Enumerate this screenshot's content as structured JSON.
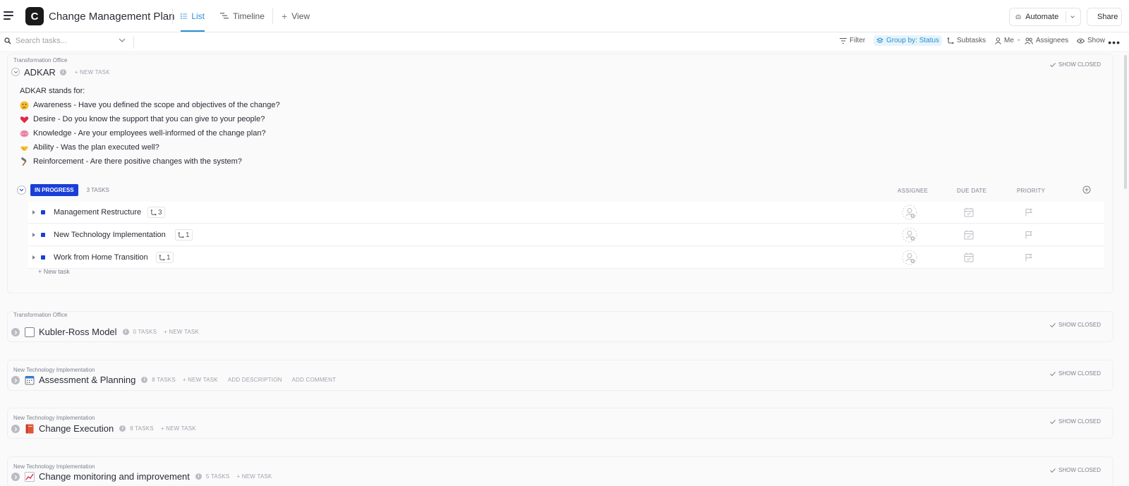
{
  "header": {
    "space_letter": "C",
    "list_title": "Change Management Plan",
    "tabs": [
      {
        "label": "List",
        "active": true
      },
      {
        "label": "Timeline",
        "active": false
      },
      {
        "label": "View",
        "active": false
      }
    ],
    "automate_label": "Automate",
    "share_label": "Share"
  },
  "toolbar": {
    "search_placeholder": "Search tasks...",
    "filter": "Filter",
    "group_by": "Group by: Status",
    "subtasks": "Subtasks",
    "me": "Me",
    "assignees": "Assignees",
    "show": "Show",
    "more": "•••"
  },
  "groups": [
    {
      "crumb": "Transformation Office",
      "name": "ADKAR",
      "new_task": "+ NEW TASK",
      "show_closed": "SHOW CLOSED",
      "description": {
        "intro": "ADKAR stands for:",
        "lines": [
          {
            "emoji": "thinking",
            "text": "Awareness - Have you defined the scope and objectives of the change?"
          },
          {
            "emoji": "heart",
            "text": "Desire - Do you know the support that you can give to your people?"
          },
          {
            "emoji": "brain",
            "text": "Knowledge - Are your employees well-informed of the change plan?"
          },
          {
            "emoji": "handshake",
            "text": "Ability - Was the plan executed well?"
          },
          {
            "emoji": "hammer",
            "text": "Reinforcement - Are there positive changes with the system?"
          }
        ]
      },
      "status": {
        "label": "IN PROGRESS",
        "count": "3 TASKS",
        "color": "#1a3fd8",
        "columns": {
          "assignee": "ASSIGNEE",
          "due_date": "DUE DATE",
          "priority": "PRIORITY"
        }
      },
      "tasks": [
        {
          "name": "Management Restructure",
          "subtasks": "3"
        },
        {
          "name": "New Technology Implementation",
          "subtasks": "1"
        },
        {
          "name": "Work from Home Transition",
          "subtasks": "1"
        }
      ],
      "new_task_row": "+ New task"
    },
    {
      "crumb": "Transformation Office",
      "name": "Kubler-Ross Model",
      "icon": "blank-page",
      "count": "0 TASKS",
      "new_task": "+ NEW TASK",
      "show_closed": "SHOW CLOSED"
    },
    {
      "crumb": "New Technology Implementation",
      "name": "Assessment & Planning",
      "icon": "calendar",
      "count": "8 TASKS",
      "new_task": "+ NEW TASK",
      "add_description": "ADD DESCRIPTION",
      "add_comment": "ADD COMMENT",
      "show_closed": "SHOW CLOSED"
    },
    {
      "crumb": "New Technology Implementation",
      "name": "Change Execution",
      "icon": "book",
      "count": "8 TASKS",
      "new_task": "+ NEW TASK",
      "show_closed": "SHOW CLOSED"
    },
    {
      "crumb": "New Technology Implementation",
      "name": "Change monitoring and improvement",
      "icon": "chart-up",
      "count": "5 TASKS",
      "new_task": "+ NEW TASK",
      "show_closed": "SHOW CLOSED"
    }
  ]
}
